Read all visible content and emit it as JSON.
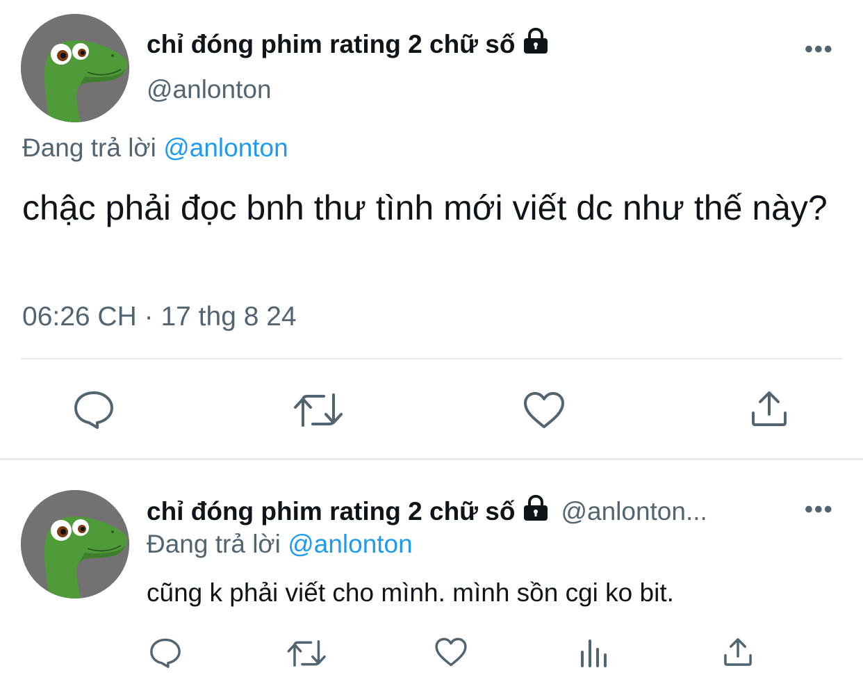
{
  "main_tweet": {
    "display_name": "chỉ đóng phim rating 2 chữ số",
    "handle": "@anlonton",
    "replying_prefix": "Đang trả lời",
    "replying_to": "@anlonton",
    "text": "chậc phải đọc bnh thư tình mới viết dc như thế này?",
    "time": "06:26 CH",
    "separator": "·",
    "date": "17 thg 8 24",
    "more_label": "•••",
    "actions": [
      "reply-icon",
      "retweet-icon",
      "like-icon",
      "share-icon"
    ]
  },
  "reply_tweet": {
    "display_name": "chỉ đóng phim rating 2 chữ số",
    "handle": "@anlonton...",
    "replying_prefix": "Đang trả lời",
    "replying_to": "@anlonton",
    "text": "cũng k phải viết cho mình. mình sồn cgi ko bit.",
    "more_label": "•••",
    "actions": [
      "reply-icon",
      "retweet-icon",
      "like-icon",
      "views-icon",
      "share-icon"
    ]
  },
  "colors": {
    "text": "#0f1419",
    "secondary": "#536471",
    "link": "#1d9bf0",
    "divider": "#e7e9eb",
    "avatar_bg": "#737171",
    "dino_green": "#4f9b3a"
  }
}
